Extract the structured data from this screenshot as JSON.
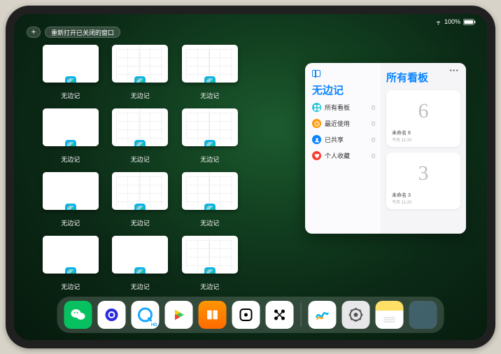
{
  "status": {
    "battery_text": "100%"
  },
  "topbar": {
    "plus_label": "+",
    "reopen_label": "重新打开已关闭的窗口"
  },
  "window_label": "无边记",
  "windows": [
    {
      "variant": "blank"
    },
    {
      "variant": "split"
    },
    {
      "variant": "split"
    },
    null,
    {
      "variant": "blank"
    },
    {
      "variant": "split"
    },
    {
      "variant": "split"
    },
    null,
    {
      "variant": "blank"
    },
    {
      "variant": "split"
    },
    {
      "variant": "split"
    },
    null,
    {
      "variant": "blank"
    },
    {
      "variant": "blank"
    },
    {
      "variant": "split"
    },
    null
  ],
  "detail": {
    "app_title": "无边记",
    "sidebar": [
      {
        "icon": "cyan",
        "label": "所有看板",
        "count": "0"
      },
      {
        "icon": "orange",
        "label": "最近使用",
        "count": "0"
      },
      {
        "icon": "blue",
        "label": "已共享",
        "count": "0"
      },
      {
        "icon": "red",
        "label": "个人收藏",
        "count": "0"
      }
    ],
    "boards_title": "所有看板",
    "boards": [
      {
        "glyph": "6",
        "caption": "未命名 6",
        "sub": "今天 11:20"
      },
      {
        "glyph": "3",
        "caption": "未命名 3",
        "sub": "今天 11:20"
      }
    ]
  },
  "dock_icons": [
    {
      "name": "wechat"
    },
    {
      "name": "quark"
    },
    {
      "name": "qqbrowser"
    },
    {
      "name": "play"
    },
    {
      "name": "books"
    },
    {
      "name": "dice"
    },
    {
      "name": "connect"
    },
    {
      "sep": true
    },
    {
      "name": "freeform"
    },
    {
      "name": "settings"
    },
    {
      "name": "notes"
    },
    {
      "name": "folder"
    }
  ]
}
